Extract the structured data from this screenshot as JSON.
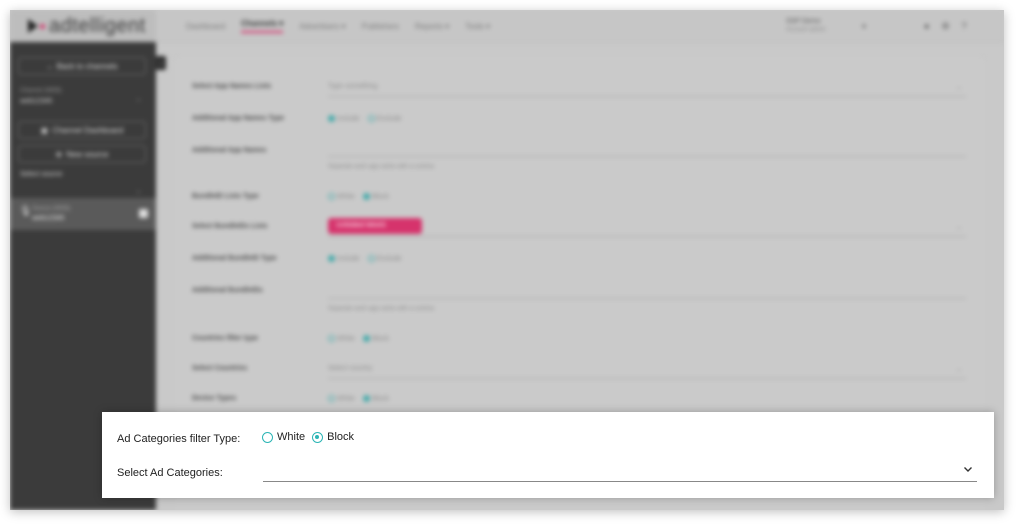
{
  "brand": {
    "name": "adtelligent",
    "accent": "#d6336c"
  },
  "sidebar": {
    "back_label": "← Back to channels",
    "channel_caption": "Channel (WEB)",
    "channel_name": "web12345",
    "dashboard_label": "Channel Dashboard",
    "new_source_label": "New source",
    "select_source_label": "Select source",
    "source_caption": "Source (WEB)",
    "source_name": "web12345"
  },
  "topbar": {
    "nav": [
      "Dashboard",
      "Channels ▾",
      "Advertisers ▾",
      "Publishers",
      "Reports ▾",
      "Tools ▾"
    ],
    "user_name": "SSP Demo",
    "user_sub": "Account admin"
  },
  "form": {
    "rows": [
      {
        "label": "Select App Names Lists",
        "value": "Type something",
        "type": "select"
      },
      {
        "label": "Additional App Names Type",
        "options": [
          "Include",
          "Exclude"
        ],
        "checked": 0,
        "type": "radio"
      },
      {
        "label": "Additional App Names",
        "hint": "Separate each app name with a comma",
        "type": "text"
      },
      {
        "label": "BundleID Lists Type",
        "options": [
          "White",
          "Block"
        ],
        "checked": 1,
        "type": "radio"
      },
      {
        "label": "Select BundleIDs Lists",
        "chip": "Unfolded MAAS",
        "type": "select"
      },
      {
        "label": "Additional BundleID Type",
        "options": [
          "Include",
          "Exclude"
        ],
        "checked": 0,
        "type": "radio"
      },
      {
        "label": "Additional BundleIDs",
        "hint": "Separate each app name with a comma",
        "type": "text"
      },
      {
        "label": "Countries filter type",
        "options": [
          "White",
          "Block"
        ],
        "checked": 1,
        "type": "radio"
      },
      {
        "label": "Select Countries",
        "value": "Select country",
        "type": "select"
      },
      {
        "label": "Device Types",
        "options": [
          "White",
          "Block"
        ],
        "checked": 1,
        "type": "radio"
      }
    ]
  },
  "panel": {
    "filter_type_label": "Ad Categories filter Type:",
    "option_white": "White",
    "option_block": "Block",
    "selected": "Block",
    "select_label": "Select Ad Categories:",
    "select_value": ""
  },
  "colors": {
    "radio": "#2bb5b5",
    "sidebar": "#3b3b3b"
  }
}
